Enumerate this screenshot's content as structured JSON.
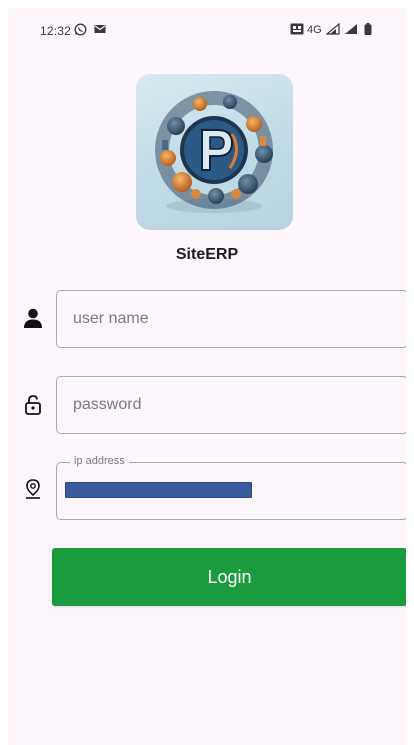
{
  "status_bar": {
    "time": "12:32",
    "network": "4G",
    "icons": [
      "whatsapp-icon",
      "mail-icon",
      "vpn-icon",
      "signal-icon",
      "signal-icon",
      "battery-icon"
    ]
  },
  "app": {
    "logo_icon": "app-logo-p",
    "title": "SiteERP"
  },
  "form": {
    "username": {
      "placeholder": "user name",
      "value": "",
      "icon": "person-icon"
    },
    "password": {
      "placeholder": "password",
      "value": "",
      "icon": "unlock-icon"
    },
    "ip_address": {
      "label": "ip address",
      "value": "",
      "redacted": true,
      "icon": "location-pin-icon"
    },
    "login_label": "Login"
  },
  "colors": {
    "background": "#fdf7fd",
    "accent": "#1a9c3e",
    "redaction": "#3a5a9e"
  }
}
